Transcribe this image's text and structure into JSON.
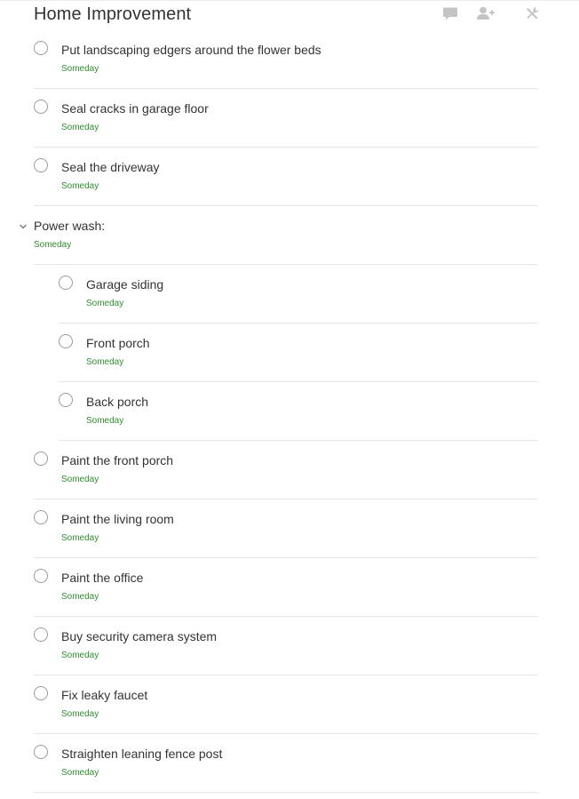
{
  "project": {
    "title": "Home Improvement"
  },
  "header_actions": {
    "comment_icon": "comment-icon",
    "share_icon": "add-person-icon",
    "settings_icon": "tools-icon"
  },
  "colors": {
    "due": "#2f8f2f",
    "text": "#333333",
    "icon": "#c4c4c4"
  },
  "tasks": [
    {
      "label": "Put landscaping edgers around the flower beds",
      "due": "Someday"
    },
    {
      "label": "Seal cracks in garage floor",
      "due": "Someday"
    },
    {
      "label": "Seal the driveway",
      "due": "Someday"
    }
  ],
  "section": {
    "label": "Power wash:",
    "due": "Someday",
    "subtasks": [
      {
        "label": "Garage siding",
        "due": "Someday"
      },
      {
        "label": "Front porch",
        "due": "Someday"
      },
      {
        "label": "Back porch",
        "due": "Someday"
      }
    ]
  },
  "tasks_after": [
    {
      "label": "Paint the front porch",
      "due": "Someday"
    },
    {
      "label": "Paint the living room",
      "due": "Someday"
    },
    {
      "label": "Paint the office",
      "due": "Someday"
    },
    {
      "label": "Buy security camera system",
      "due": "Someday"
    },
    {
      "label": "Fix leaky faucet",
      "due": "Someday"
    },
    {
      "label": "Straighten leaning fence post",
      "due": "Someday"
    }
  ]
}
